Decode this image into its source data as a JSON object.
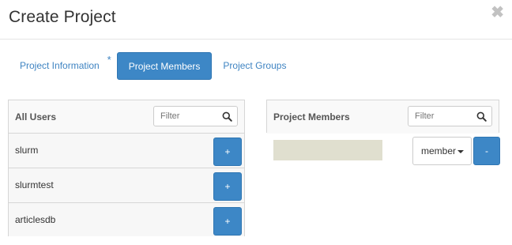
{
  "modal": {
    "title": "Create Project",
    "close_symbol": "✖"
  },
  "tabs": [
    {
      "label": "Project Information",
      "required_mark": "*"
    },
    {
      "label": "Project Members"
    },
    {
      "label": "Project Groups"
    }
  ],
  "all_users": {
    "title": "All Users",
    "filter_placeholder": "Filter",
    "add_label": "+",
    "items": [
      "slurm",
      "slurmtest",
      "articlesdb"
    ]
  },
  "project_members": {
    "title": "Project Members",
    "filter_placeholder": "Filter",
    "role_selected": "member",
    "remove_label": "-"
  },
  "colors": {
    "accent": "#3d87c6",
    "link": "#3f84c2",
    "placeholder_block": "#e0dfcf"
  },
  "icons": {
    "close": "close-icon",
    "filter": "search-icon",
    "dropdown": "caret-down-icon"
  }
}
